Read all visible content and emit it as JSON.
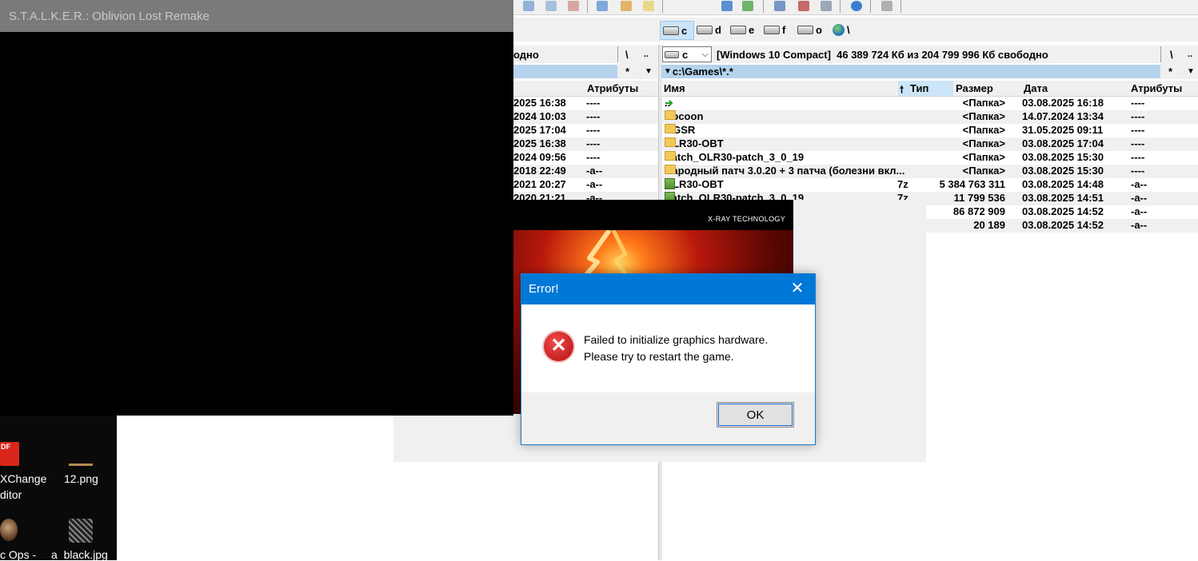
{
  "stalker_window": {
    "title": "S.T.A.L.K.E.R.: Oblivion Lost Remake"
  },
  "desktop": {
    "icons": [
      {
        "label_line1": "XChange",
        "label_line2": "ditor",
        "icon": "pdf-xchange-icon"
      },
      {
        "label_line1": "12.png",
        "label_line2": "",
        "icon": "image-file-icon"
      },
      {
        "label_line1": "c Ops -",
        "label_line2": "",
        "icon": "game-shortcut-icon"
      },
      {
        "label_line1": "a_black.jpg",
        "label_line2": "",
        "icon": "image-file-icon"
      }
    ],
    "pdf_badge": "DF"
  },
  "total_commander": {
    "drives": [
      "c",
      "d",
      "e",
      "f",
      "o"
    ],
    "network_root": "\\",
    "left_panel": {
      "free_space_fragment": "одно",
      "root_btn": "\\",
      "up_btn": "..",
      "filter_star": "*",
      "attr_header": "Атрибуты",
      "rows": [
        {
          "date": "2025 16:38",
          "attr": "----"
        },
        {
          "date": "2024 10:03",
          "attr": "----"
        },
        {
          "date": "2025 17:04",
          "attr": "----"
        },
        {
          "date": "2025 16:38",
          "attr": "----"
        },
        {
          "date": "2024 09:56",
          "attr": "----"
        },
        {
          "date": "2018 22:49",
          "attr": "-a--"
        },
        {
          "date": "2021 20:27",
          "attr": "-a--"
        },
        {
          "date": "2020 21:21",
          "attr": "-a--"
        }
      ]
    },
    "right_panel": {
      "drive_select": "c",
      "drive_info": "[Windows 10 Compact]  46 389 724 Кб из 204 799 996 Кб свободно",
      "root_btn": "\\",
      "up_btn": "..",
      "path": "c:\\Games\\*.*",
      "filter_star": "*",
      "columns": {
        "name": "Имя",
        "type": "Тип",
        "size": "Размер",
        "date": "Дата",
        "attr": "Атрибуты"
      },
      "rows": [
        {
          "name": "..",
          "type": "",
          "size": "<Папка>",
          "date": "03.08.2025 16:18",
          "attr": "----",
          "kind": "up"
        },
        {
          "name": "Cocoon",
          "type": "",
          "size": "<Папка>",
          "date": "14.07.2024 13:34",
          "attr": "----",
          "kind": "folder"
        },
        {
          "name": "OGSR",
          "type": "",
          "size": "<Папка>",
          "date": "31.05.2025 09:11",
          "attr": "----",
          "kind": "folder"
        },
        {
          "name": "OLR30-OBT",
          "type": "",
          "size": "<Папка>",
          "date": "03.08.2025 17:04",
          "attr": "----",
          "kind": "folder"
        },
        {
          "name": "Patch_OLR30-patch_3_0_19",
          "type": "",
          "size": "<Папка>",
          "date": "03.08.2025 15:30",
          "attr": "----",
          "kind": "folder"
        },
        {
          "name": "Народный патч 3.0.20 + 3 патча (болезни вкл...",
          "type": "",
          "size": "<Папка>",
          "date": "03.08.2025 15:30",
          "attr": "----",
          "kind": "folder"
        },
        {
          "name": "OLR30-OBT",
          "type": "7z",
          "size": "5 384 763 311",
          "date": "03.08.2025 14:48",
          "attr": "-a--",
          "kind": "archive"
        },
        {
          "name": "Patch_OLR30-patch_3_0_19",
          "type": "7z",
          "size": "11 799 536",
          "date": "03.08.2025 14:51",
          "attr": "-a--",
          "kind": "archive"
        },
        {
          "name": "",
          "type": "",
          "size": "86 872 909",
          "date": "03.08.2025 14:52",
          "attr": "-a--",
          "kind": "hidden"
        },
        {
          "name": "",
          "type": "",
          "size": "20 189",
          "date": "03.08.2025 14:52",
          "attr": "-a--",
          "kind": "hidden"
        }
      ]
    }
  },
  "splash": {
    "brand": "X-RAY TECHNOLOGY"
  },
  "error_dialog": {
    "title": "Error!",
    "close_glyph": "✕",
    "line1": "Failed to initialize graphics hardware.",
    "line2": "Please try to restart the game.",
    "ok_label": "OK",
    "error_glyph": "✕"
  },
  "colors": {
    "dialog_title": "#0078d7",
    "panel_path_bg": "#b6d3ee",
    "stalker_title_bg": "#7a7a7a"
  }
}
